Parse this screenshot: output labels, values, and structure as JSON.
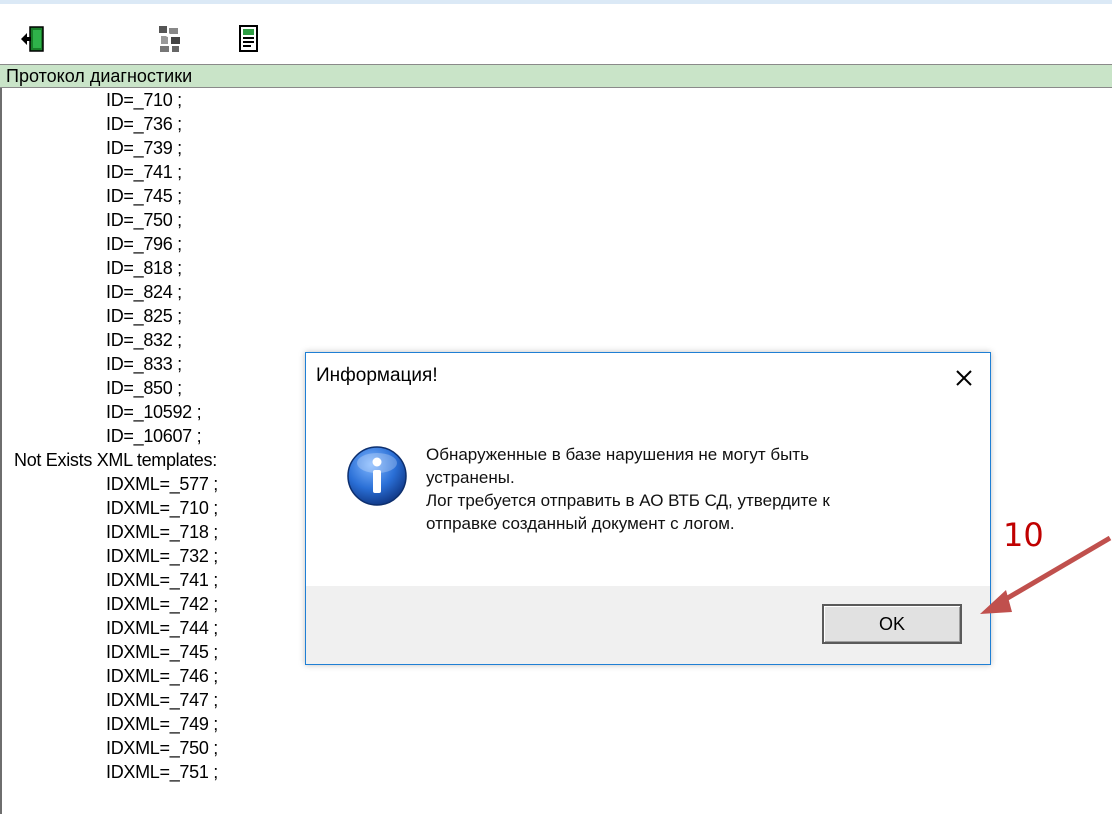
{
  "toolbar": {
    "icons": [
      {
        "name": "exit-door-icon"
      },
      {
        "name": "diagnostics-icon"
      },
      {
        "name": "document-icon"
      }
    ]
  },
  "panel": {
    "title": "Протокол диагностики"
  },
  "log_lines": [
    {
      "text": "ID=_710 ;",
      "indent": true
    },
    {
      "text": "ID=_736 ;",
      "indent": true
    },
    {
      "text": "ID=_739 ;",
      "indent": true
    },
    {
      "text": "ID=_741 ;",
      "indent": true
    },
    {
      "text": "ID=_745 ;",
      "indent": true
    },
    {
      "text": "ID=_750 ;",
      "indent": true
    },
    {
      "text": "ID=_796 ;",
      "indent": true
    },
    {
      "text": "ID=_818 ;",
      "indent": true
    },
    {
      "text": "ID=_824 ;",
      "indent": true
    },
    {
      "text": "ID=_825 ;",
      "indent": true
    },
    {
      "text": "ID=_832 ;",
      "indent": true
    },
    {
      "text": "ID=_833 ;",
      "indent": true
    },
    {
      "text": "ID=_850 ;",
      "indent": true
    },
    {
      "text": "ID=_10592 ;",
      "indent": true
    },
    {
      "text": "ID=_10607 ;",
      "indent": true
    },
    {
      "text": "Not Exists XML templates:",
      "indent": false
    },
    {
      "text": "IDXML=_577 ;",
      "indent": true
    },
    {
      "text": "IDXML=_710 ;",
      "indent": true
    },
    {
      "text": "IDXML=_718 ;",
      "indent": true
    },
    {
      "text": "IDXML=_732 ;",
      "indent": true
    },
    {
      "text": "IDXML=_741 ;",
      "indent": true
    },
    {
      "text": "IDXML=_742 ;",
      "indent": true
    },
    {
      "text": "IDXML=_744 ;",
      "indent": true
    },
    {
      "text": "IDXML=_745 ;",
      "indent": true
    },
    {
      "text": "IDXML=_746 ;",
      "indent": true
    },
    {
      "text": "IDXML=_747 ;",
      "indent": true
    },
    {
      "text": "IDXML=_749 ;",
      "indent": true
    },
    {
      "text": "IDXML=_750 ;",
      "indent": true
    },
    {
      "text": "IDXML=_751 ;",
      "indent": true
    }
  ],
  "dialog": {
    "title": "Информация!",
    "close_icon": "close-icon",
    "info_icon": "info-icon",
    "message_lines": [
      "Обнаруженные в базе нарушения не могут быть",
      "устранены.",
      "Лог требуется отправить в АО ВТБ СД, утвердите к",
      "отправке созданный документ с логом."
    ],
    "ok_label": "OK"
  },
  "annotation": {
    "step_number": "10",
    "color": "#c00000"
  },
  "colors": {
    "panel_header_bg": "#c9e4c8",
    "dialog_border": "#1f7fd4",
    "dialog_footer_bg": "#f0f0f0"
  }
}
